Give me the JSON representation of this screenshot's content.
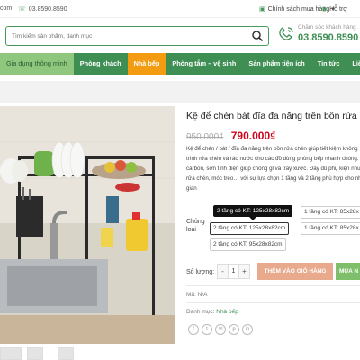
{
  "topbar": {
    "left_text": "com",
    "phone": "03.8590.8590",
    "policy": "Chính sách mua hàng",
    "policy_arrow": "▾",
    "support": "Hỗ trợ"
  },
  "header": {
    "search_placeholder": "Tìm kiếm sản phẩm, danh mục",
    "hotline_title": "Chăm sóc khách hàng",
    "hotline_number": "03.8590.8590"
  },
  "nav": {
    "items": [
      {
        "label": "Gia dụng thông minh"
      },
      {
        "label": "Phòng khách"
      },
      {
        "label": "Nhà bếp"
      },
      {
        "label": "Phòng tắm – vệ sinh"
      },
      {
        "label": "Sản phẩm tiện ích"
      },
      {
        "label": "Tin tức"
      },
      {
        "label": "Liên hệ"
      }
    ],
    "active": "Nhà bếp"
  },
  "product": {
    "title": "Kệ để chén bát đĩa đa năng trên bồn rửa",
    "old_price": "950.000₫",
    "new_price": "790.000₫",
    "description_lines": [
      "Kệ để chén / bát / đĩa đa năng trên bồn rửa chén giúp tiết kiệm không",
      "trình rửa chén và ráo nước cho các đồ dùng phòng bếp nhanh chóng. K",
      "carbon, sơn tĩnh điện giúp chống gỉ và trầy xước. Đầy đủ phụ kiện nhu",
      "rửa chén, móc treo… với sự lựa chọn 1 tầng và 2 tầng phù hợp cho nh",
      "gian"
    ],
    "variant_label": "Chủng loại",
    "tooltip": "2 tầng có KT: 125x28x82cm",
    "options": [
      "1 tầng có KT: 85x28x",
      "2 tầng có KT: 125x28x82cm",
      "1 tầng có KT: 85x28x",
      "2 tầng có KT: 95x28x82cm"
    ],
    "qty_label": "Số lượng:",
    "qty_minus": "-",
    "qty_value": "1",
    "qty_plus": "+",
    "add_to_cart": "THÊM VÀO GIỎ HÀNG",
    "buy_now": "MUA N",
    "sku_label": "Mã: N/A",
    "category_label": "Danh mục:",
    "category_value": "Nhà bếp",
    "social": [
      "f",
      "t",
      "✉",
      "p",
      "in"
    ]
  },
  "colors": {
    "brand_green": "#3f8f55",
    "nav_active": "#f39c12",
    "price_red": "#d0021b"
  }
}
